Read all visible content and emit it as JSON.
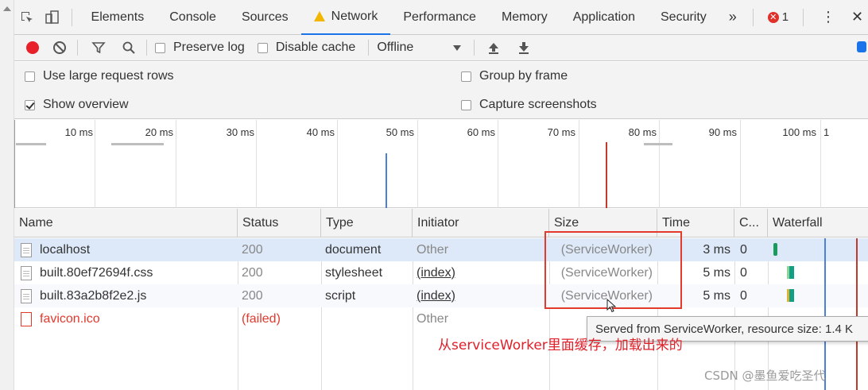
{
  "tabs": {
    "items": [
      {
        "label": "Elements"
      },
      {
        "label": "Console"
      },
      {
        "label": "Sources"
      },
      {
        "label": "Network"
      },
      {
        "label": "Performance"
      },
      {
        "label": "Memory"
      },
      {
        "label": "Application"
      },
      {
        "label": "Security"
      }
    ],
    "more": "»",
    "error_count": "1",
    "active": "Network"
  },
  "toolbar": {
    "preserve_log": "Preserve log",
    "disable_cache": "Disable cache",
    "throttle": "Offline"
  },
  "settings": {
    "large_rows": "Use large request rows",
    "group_by_frame": "Group by frame",
    "show_overview": "Show overview",
    "capture_screenshots": "Capture screenshots",
    "show_overview_checked": true
  },
  "overview": {
    "ticks": [
      "10 ms",
      "20 ms",
      "30 ms",
      "40 ms",
      "50 ms",
      "60 ms",
      "70 ms",
      "80 ms",
      "90 ms",
      "100 ms",
      "1"
    ]
  },
  "table": {
    "columns": [
      "Name",
      "Status",
      "Type",
      "Initiator",
      "Size",
      "Time",
      "C...",
      "Waterfall"
    ],
    "rows": [
      {
        "name": "localhost",
        "status": "200",
        "type": "document",
        "initiator": "Other",
        "size": "(ServiceWorker)",
        "time": "3 ms",
        "c": "0"
      },
      {
        "name": "built.80ef72694f.css",
        "status": "200",
        "type": "stylesheet",
        "initiator": "(index)",
        "size": "(ServiceWorker)",
        "time": "5 ms",
        "c": "0"
      },
      {
        "name": "built.83a2b8f2e2.js",
        "status": "200",
        "type": "script",
        "initiator": "(index)",
        "size": "(ServiceWorker)",
        "time": "5 ms",
        "c": "0"
      },
      {
        "name": "favicon.ico",
        "status": "(failed)",
        "type": "",
        "initiator": "Other",
        "size": "",
        "time": "",
        "c": ""
      }
    ]
  },
  "tooltip": "Served from ServiceWorker, resource size: 1.4 K",
  "annotation": "从serviceWorker里面缓存，加载出来的",
  "watermark": "CSDN @墨鱼爱吃圣代",
  "colors": {
    "accent": "#1a73e8",
    "record": "#e8202a",
    "error": "#e03a2e",
    "highlight": "#e23b2e",
    "selected_row": "#dde9f8"
  }
}
